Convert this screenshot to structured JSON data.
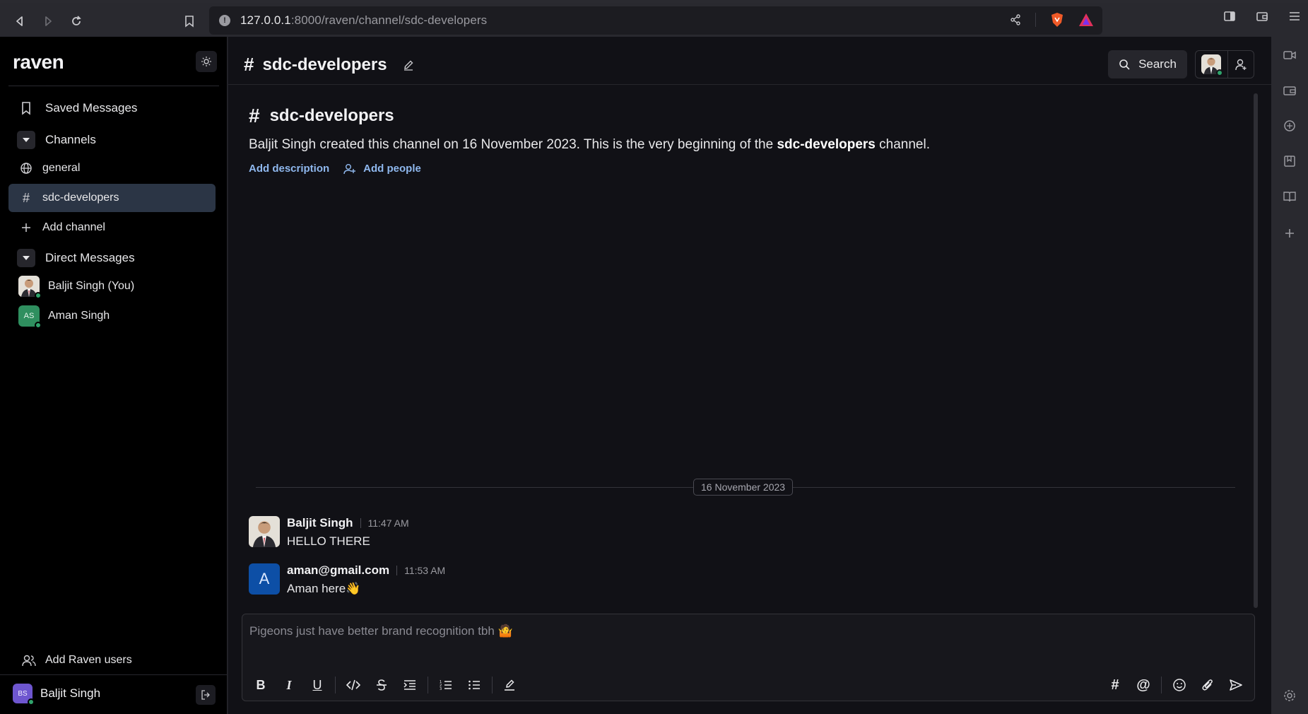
{
  "browser": {
    "url_host": "127.0.0.1",
    "url_rest": ":8000/raven/channel/sdc-developers"
  },
  "sidebar": {
    "logo": "raven",
    "saved_messages": "Saved Messages",
    "channels_header": "Channels",
    "channels": [
      {
        "label": "general",
        "icon": "globe-icon"
      },
      {
        "label": "sdc-developers",
        "icon": "hash-icon",
        "active": true
      }
    ],
    "add_channel": "Add channel",
    "dm_header": "Direct Messages",
    "dms": [
      {
        "label": "Baljit Singh (You)",
        "avatar": "photo"
      },
      {
        "label": "Aman Singh",
        "initials": "AS"
      }
    ],
    "add_users": "Add Raven users",
    "current_user": {
      "name": "Baljit Singh",
      "initials": "BS"
    }
  },
  "header": {
    "channel_name": "sdc-developers",
    "search_label": "Search"
  },
  "intro": {
    "title": "sdc-developers",
    "desc_prefix": "Baljit Singh created this channel on 16 November 2023. This is the very beginning of the ",
    "desc_channel": "sdc-developers",
    "desc_suffix": " channel.",
    "add_description": "Add description",
    "add_people": "Add people"
  },
  "date_separator": "16 November 2023",
  "messages": [
    {
      "author": "Baljit Singh",
      "time": "11:47 AM",
      "text": "HELLO THERE"
    },
    {
      "author": "aman@gmail.com",
      "time": "11:53 AM",
      "text": "Aman here👋",
      "initial": "A"
    }
  ],
  "composer": {
    "placeholder": "Pigeons just have better brand recognition tbh 🤷"
  },
  "colors": {
    "accent": "#8fb8ee",
    "active_item": "#2b3545",
    "online": "#30a46c",
    "aman_avatar": "#0d4fa6"
  }
}
